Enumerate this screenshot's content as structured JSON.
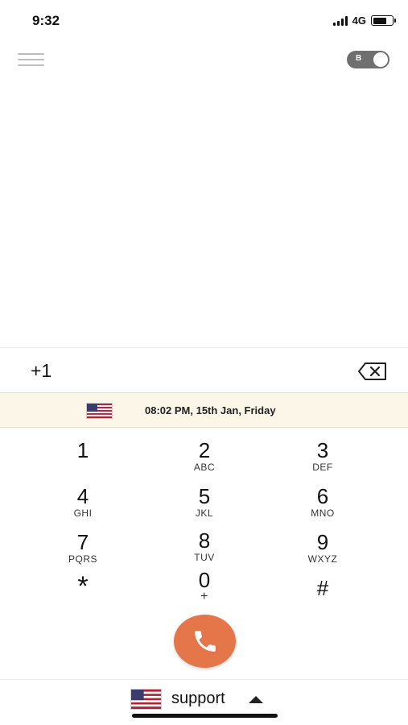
{
  "status_bar": {
    "time": "9:32",
    "network": "4G",
    "battery_level": 0.7
  },
  "header": {
    "toggle_letter": "B",
    "toggle_on": true
  },
  "dialer": {
    "number": "+1"
  },
  "banner": {
    "flag": "us-flag-icon",
    "local_time": "08:02 PM, 15th Jan, Friday"
  },
  "keypad": {
    "keys": [
      {
        "digit": "1",
        "letters": ""
      },
      {
        "digit": "2",
        "letters": "ABC"
      },
      {
        "digit": "3",
        "letters": "DEF"
      },
      {
        "digit": "4",
        "letters": "GHI"
      },
      {
        "digit": "5",
        "letters": "JKL"
      },
      {
        "digit": "6",
        "letters": "MNO"
      },
      {
        "digit": "7",
        "letters": "PQRS"
      },
      {
        "digit": "8",
        "letters": "TUV"
      },
      {
        "digit": "9",
        "letters": "WXYZ"
      },
      {
        "digit": "*",
        "letters": ""
      },
      {
        "digit": "0",
        "letters": "+"
      },
      {
        "digit": "#",
        "letters": ""
      }
    ]
  },
  "call": {
    "icon": "phone-icon",
    "color": "#e4764a"
  },
  "footer": {
    "account_label": "support",
    "flag": "us-flag-icon"
  }
}
